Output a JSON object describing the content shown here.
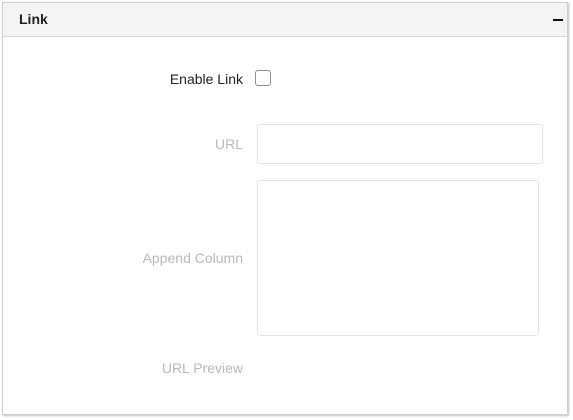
{
  "panel": {
    "title": "Link",
    "collapse_symbol": "–"
  },
  "form": {
    "enable_link": {
      "label": "Enable Link",
      "checked": false
    },
    "url": {
      "label": "URL",
      "value": "",
      "placeholder": ""
    },
    "append_column": {
      "label": "Append Column",
      "value": ""
    },
    "url_preview": {
      "label": "URL Preview",
      "value": ""
    }
  },
  "colors": {
    "header_bg": "#f4f4f4",
    "active_label": "#222222",
    "disabled_label": "#b8b8b8",
    "field_border": "#e4e4e4"
  },
  "icons": {
    "collapse": "minus-icon"
  }
}
